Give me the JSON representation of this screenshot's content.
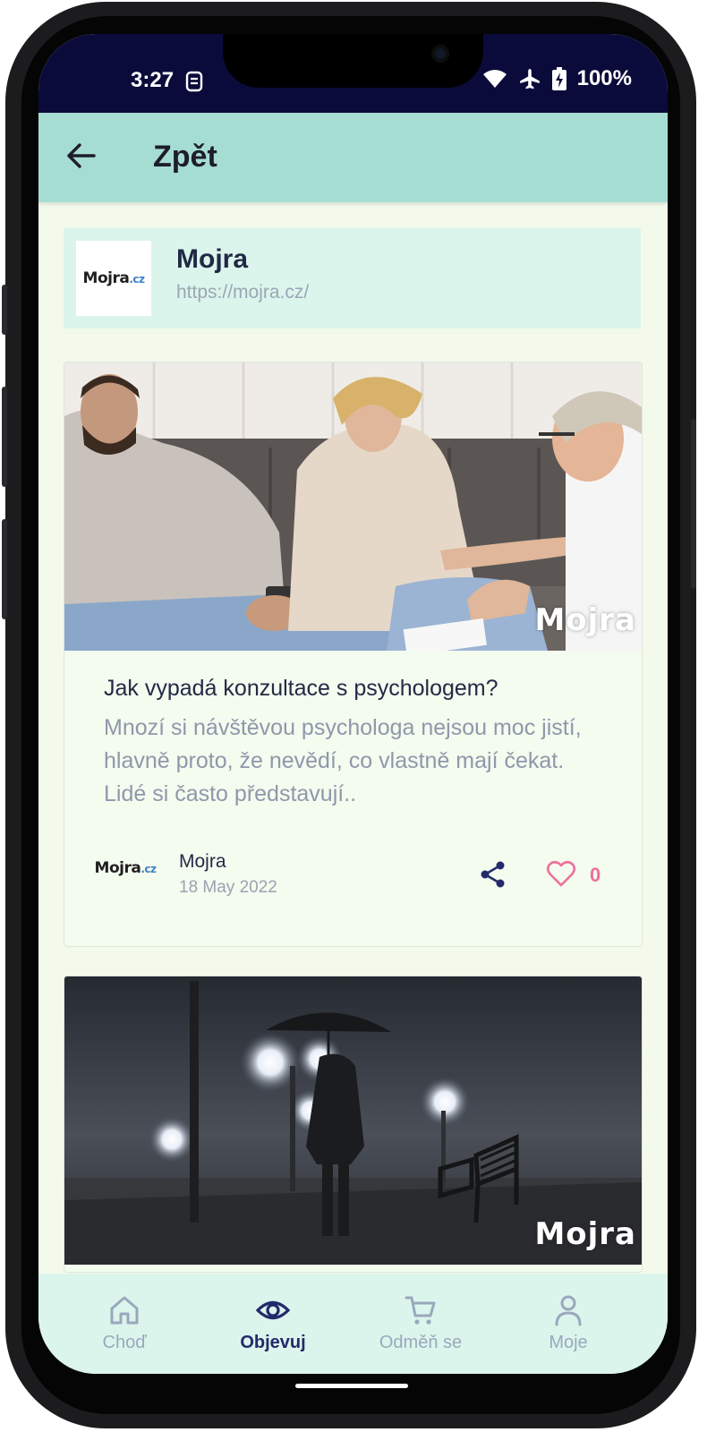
{
  "status_bar": {
    "time": "3:27",
    "battery": "100%",
    "icons": [
      "sim-icon",
      "wifi-icon",
      "airplane-icon",
      "battery-charging-icon"
    ]
  },
  "app_bar": {
    "back_icon": "arrow-left-icon",
    "title": "Zpět"
  },
  "publisher": {
    "logo_text": "Mojra",
    "logo_suffix": ".cz",
    "name": "Mojra",
    "url": "https://mojra.cz/"
  },
  "articles": [
    {
      "image": "photo of a couple on a sofa in a consultation with a psychologist",
      "watermark": "Mojra",
      "title": "Jak vypadá konzultace s psychologem?",
      "excerpt": "Mnozí si návštěvou psychologa nejsou moc jistí, hlavně proto, že nevědí, co vlastně mají čekat. Lidé si často představují..",
      "author_logo_text": "Mojra",
      "author_logo_suffix": ".cz",
      "author": "Mojra",
      "date": "18 May 2022",
      "likes": "0"
    },
    {
      "image": "foggy night park with a figure holding an umbrella and street lamps",
      "watermark": "Mojra"
    }
  ],
  "bottom_nav": [
    {
      "label": "Choď",
      "icon": "home-icon",
      "active": false
    },
    {
      "label": "Objevuj",
      "icon": "eye-icon",
      "active": true
    },
    {
      "label": "Odměň se",
      "icon": "cart-icon",
      "active": false
    },
    {
      "label": "Moje",
      "icon": "user-icon",
      "active": false
    }
  ],
  "colors": {
    "app_bar": "#a6ddd3",
    "background": "#f3faec",
    "status_bar": "#0b0b3b",
    "accent": "#232a6b",
    "like": "#ef6f9c",
    "muted": "#9aa8bd"
  }
}
